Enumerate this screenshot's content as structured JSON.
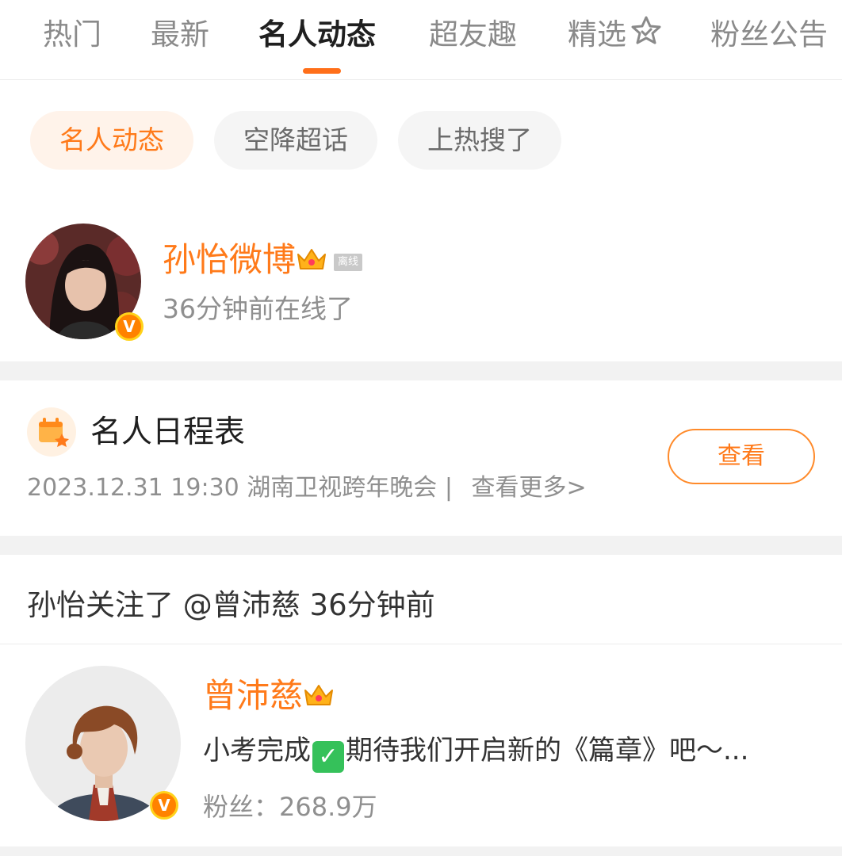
{
  "top_tabs": [
    "热门",
    "最新",
    "名人动态",
    "超友趣",
    "精选",
    "粉丝公告"
  ],
  "sub_tabs": [
    "名人动态",
    "空降超话",
    "上热搜了"
  ],
  "celebrity": {
    "name": "孙怡微博",
    "status_tag": "离线",
    "online_text": "36分钟前在线了"
  },
  "schedule": {
    "title": "名人日程表",
    "event_text": "2023.12.31 19:30 湖南卫视跨年晚会",
    "separator": "|",
    "more_link": "查看更多>",
    "view_button": "查看"
  },
  "follow_event": {
    "text": "孙怡关注了 @曾沛慈 36分钟前"
  },
  "followed_user": {
    "name": "曾沛慈",
    "desc_before": "小考完成",
    "desc_after": "期待我们开启新的《篇章》吧～...",
    "check_icon": "✓",
    "fans_label": "粉丝：",
    "fans_count": "268.9万"
  },
  "verified_badge_letter": "V",
  "colors": {
    "accent": "#ff7a1a",
    "indicator": "#ff6f1a",
    "badge": "#ff8200",
    "check": "#35c15a"
  }
}
